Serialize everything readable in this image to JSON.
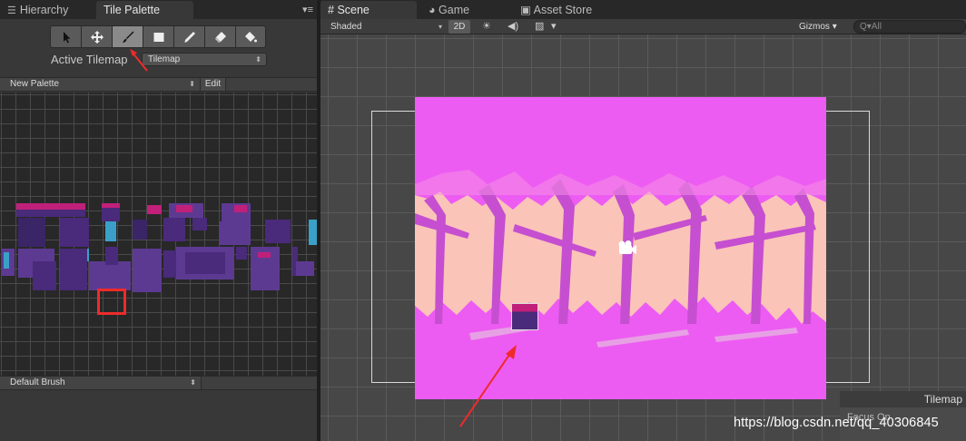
{
  "left_panel": {
    "tabs": [
      {
        "label": "Hierarchy",
        "icon": "list-icon"
      },
      {
        "label": "Tile Palette",
        "icon": ""
      }
    ],
    "menu_icon": "▾≡",
    "tools": [
      "select-tool",
      "move-tool",
      "paint-tool",
      "box-fill-tool",
      "pick-tool",
      "erase-tool",
      "flood-fill-tool"
    ],
    "active_tool_index": 2,
    "active_tilemap_label": "Active Tilemap",
    "active_tilemap_value": "Tilemap",
    "palette_name": "New Palette",
    "edit_label": "Edit",
    "brush_name": "Default Brush"
  },
  "right_panel": {
    "tabs": [
      {
        "label": "Scene"
      },
      {
        "label": "Game"
      },
      {
        "label": "Asset Store"
      }
    ],
    "shading_mode": "Shaded",
    "mode_2d": "2D",
    "gizmos_label": "Gizmos",
    "search_placeholder": "Q▾All",
    "tilemap_label": "Tilemap",
    "focus_label": "Focus On"
  },
  "watermark": "https://blog.csdn.net/qq_40306845",
  "colors": {
    "magenta_bg": "#ed5cf2",
    "tree_light": "#fbc4b8",
    "tree_mid": "#e8a8c8",
    "tree_dark": "#c54fd0",
    "highlight_red": "#ee2b2b"
  }
}
